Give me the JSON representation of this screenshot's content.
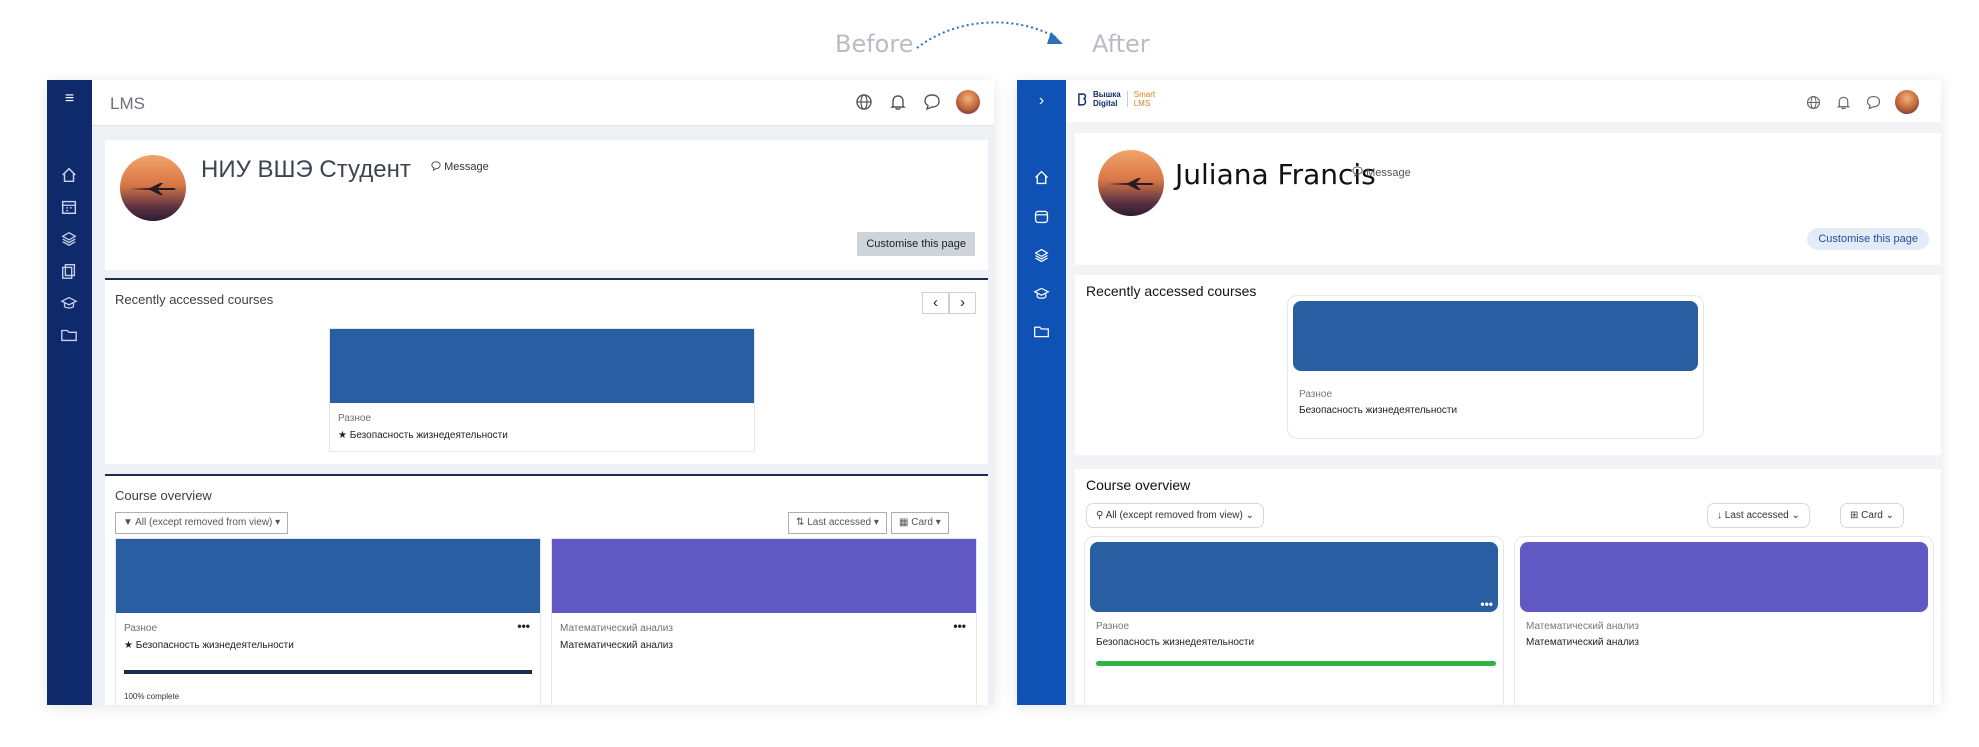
{
  "labels": {
    "before": "Before",
    "after": "After"
  },
  "before": {
    "app_title": "LMS",
    "profile": {
      "name": "НИУ ВШЭ Студент",
      "message": "Message",
      "customise": "Customise this page"
    },
    "recent": {
      "title": "Recently accessed courses",
      "prev": "‹",
      "next": "›",
      "course": {
        "category": "Разное",
        "title": "Безопасность жизнедеятельности",
        "color": "#2a5ea3"
      }
    },
    "overview": {
      "title": "Course overview",
      "filter": "All (except removed from view)",
      "sort": "Last accessed",
      "view": "Card",
      "courses": [
        {
          "category": "Разное",
          "title": "Безопасность жизнедеятельности",
          "color": "#2a5ea3",
          "progress": 100,
          "progress_label": "100% complete",
          "menu": "•••"
        },
        {
          "category": "Математический анализ",
          "title": "Математический анализ",
          "color": "#6059c4",
          "menu": "•••"
        }
      ]
    },
    "colors": {
      "rail": "#0f2a6b",
      "accent": "#1a2b56"
    }
  },
  "after": {
    "logo": {
      "left_line1": "Вышка",
      "left_line2": "Digital",
      "right_line1": "Smart",
      "right_line2": "LMS"
    },
    "profile": {
      "name": "Juliana Francis",
      "message": "Message",
      "customise": "Customise this page"
    },
    "recent": {
      "title": "Recently accessed courses",
      "course": {
        "category": "Разное",
        "title": "Безопасность жизнедеятельности",
        "color": "#2a5ea3"
      }
    },
    "overview": {
      "title": "Course overview",
      "filter": "All (except removed from view)",
      "sort": "Last accessed",
      "view": "Card",
      "courses": [
        {
          "category": "Разное",
          "title": "Безопасность жизнедеятельности",
          "color": "#2a5ea3",
          "progress": 100,
          "menu": "•••"
        },
        {
          "category": "Математический анализ",
          "title": "Математический анализ",
          "color": "#6059c4"
        }
      ]
    },
    "colors": {
      "rail": "#0f51b5",
      "progress": "#2fb344",
      "pill_bg": "#e3ebf7"
    }
  }
}
